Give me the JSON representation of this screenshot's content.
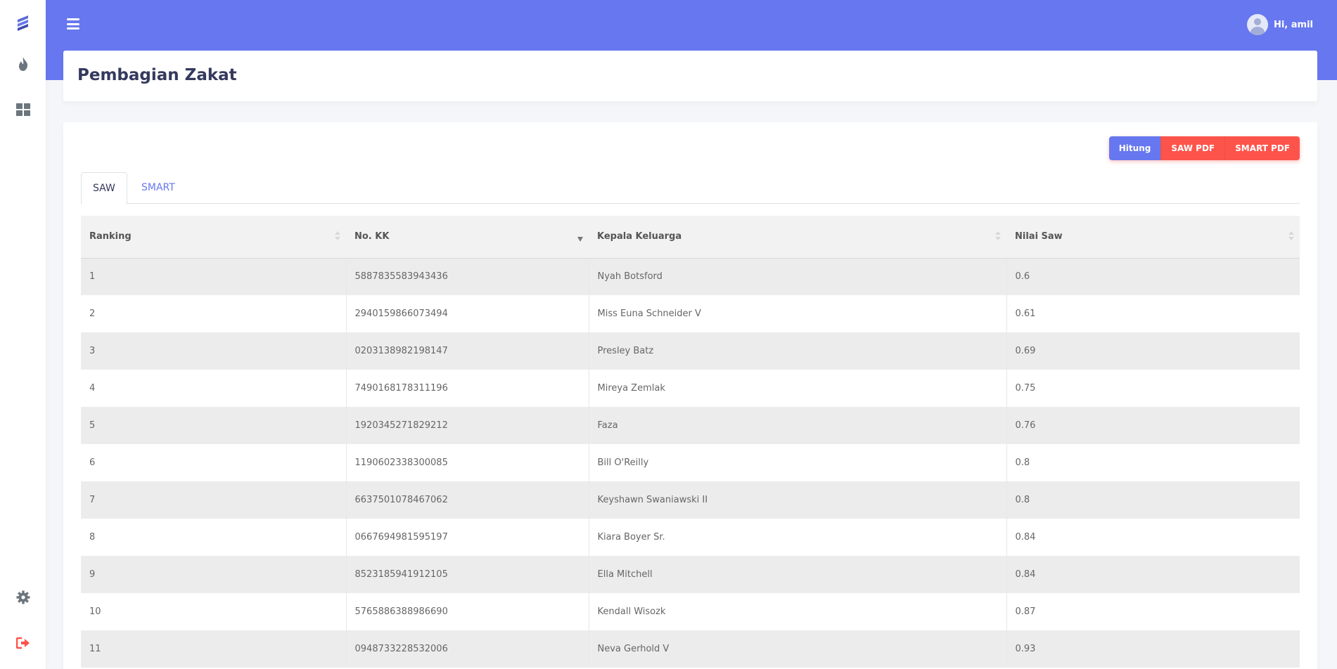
{
  "topbar": {
    "user_greeting": "Hi, amil"
  },
  "page": {
    "title": "Pembagian Zakat"
  },
  "actions": {
    "hitung": "Hitung",
    "saw_pdf": "SAW PDF",
    "smart_pdf": "SMART PDF"
  },
  "tabs": [
    {
      "label": "SAW"
    },
    {
      "label": "SMART"
    }
  ],
  "table": {
    "headers": [
      "Ranking",
      "No. KK",
      "Kepala Keluarga",
      "Nilai Saw"
    ],
    "rows": [
      [
        "1",
        "5887835583943436",
        "Nyah Botsford",
        "0.6"
      ],
      [
        "2",
        "2940159866073494",
        "Miss Euna Schneider V",
        "0.61"
      ],
      [
        "3",
        "0203138982198147",
        "Presley Batz",
        "0.69"
      ],
      [
        "4",
        "7490168178311196",
        "Mireya Zemlak",
        "0.75"
      ],
      [
        "5",
        "1920345271829212",
        "Faza",
        "0.76"
      ],
      [
        "6",
        "1190602338300085",
        "Bill O'Reilly",
        "0.8"
      ],
      [
        "7",
        "6637501078467062",
        "Keyshawn Swaniawski II",
        "0.8"
      ],
      [
        "8",
        "0667694981595197",
        "Kiara Boyer Sr.",
        "0.84"
      ],
      [
        "9",
        "8523185941912105",
        "Ella Mitchell",
        "0.84"
      ],
      [
        "10",
        "5765886388986690",
        "Kendall Wisozk",
        "0.87"
      ],
      [
        "11",
        "0948733228532006",
        "Neva Gerhold V",
        "0.93"
      ]
    ]
  },
  "colors": {
    "primary": "#6777ef",
    "danger": "#fc544b"
  },
  "icons": [
    "logo-icon",
    "fire-icon",
    "dashboard-icon",
    "settings-icon",
    "logout-icon"
  ]
}
